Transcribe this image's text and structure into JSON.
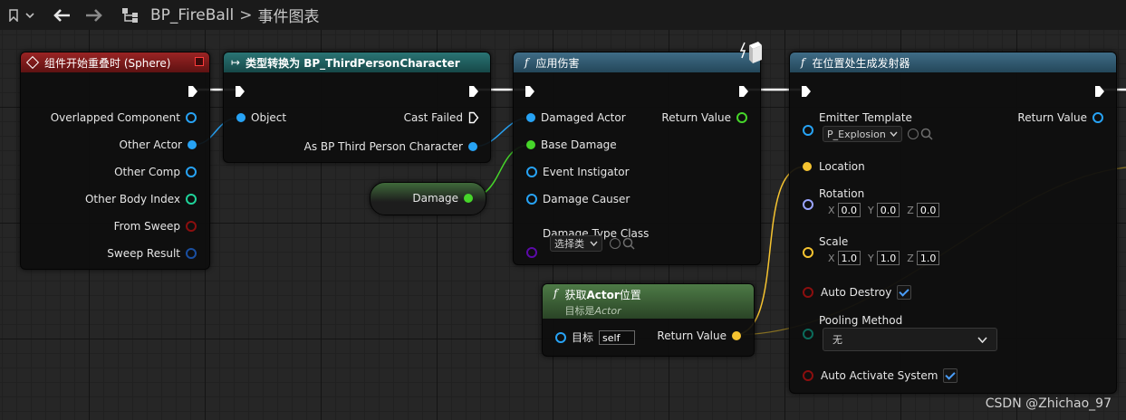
{
  "toolbar": {
    "breadcrumb_asset": "BP_FireBall",
    "breadcrumb_sep": ">",
    "breadcrumb_graph": "事件图表"
  },
  "nodes": {
    "overlap": {
      "title": "组件开始重叠时 (Sphere)",
      "pins": [
        "Overlapped Component",
        "Other Actor",
        "Other Comp",
        "Other Body Index",
        "From Sweep",
        "Sweep Result"
      ]
    },
    "cast": {
      "title": "类型转换为 BP_ThirdPersonCharacter",
      "object": "Object",
      "cast_failed": "Cast Failed",
      "as_character": "As BP Third Person Character"
    },
    "damage_var": {
      "label": "Damage"
    },
    "apply_damage": {
      "title": "应用伤害",
      "return_value": "Return Value",
      "pins": [
        "Damaged Actor",
        "Base Damage",
        "Event Instigator",
        "Damage Causer",
        "Damage Type Class"
      ],
      "class_select": "选择类"
    },
    "get_location": {
      "title_prefix": "获取",
      "title_bold": "Actor",
      "title_suffix": "位置",
      "subtitle_prefix": "目标是",
      "subtitle_target": "Actor",
      "target_label": "目标",
      "target_value": "self",
      "return_value": "Return Value"
    },
    "spawn": {
      "title": "在位置处生成发射器",
      "emitter_template": "Emitter Template",
      "emitter_value": "P_Explosion",
      "return_value": "Return Value",
      "location": "Location",
      "rotation": "Rotation",
      "rot_x": "0.0",
      "rot_y": "0.0",
      "rot_z": "0.0",
      "scale": "Scale",
      "scale_x": "1.0",
      "scale_y": "1.0",
      "scale_z": "1.0",
      "axis_x": "X",
      "axis_y": "Y",
      "axis_z": "Z",
      "auto_destroy": "Auto Destroy",
      "pooling_method": "Pooling Method",
      "pooling_value": "无",
      "auto_activate": "Auto Activate System"
    }
  },
  "watermark": "CSDN @Zhichao_97",
  "colors": {
    "event_header": "#8a1c1c",
    "cast_header": "#1f5f5f",
    "function_header": "#33586e",
    "pure_header": "#3f6a3a",
    "object_pin": "#27a3f5",
    "float_pin": "#46d62a",
    "vector_pin": "#f5c330",
    "rotator_pin": "#9aa4ff",
    "bool_pin": "#8b0f0f",
    "int_pin": "#1fd39a",
    "struct_pin": "#1a4fa1",
    "class_pin": "#5b0aa8",
    "enum_pin": "#0b6b5b"
  }
}
